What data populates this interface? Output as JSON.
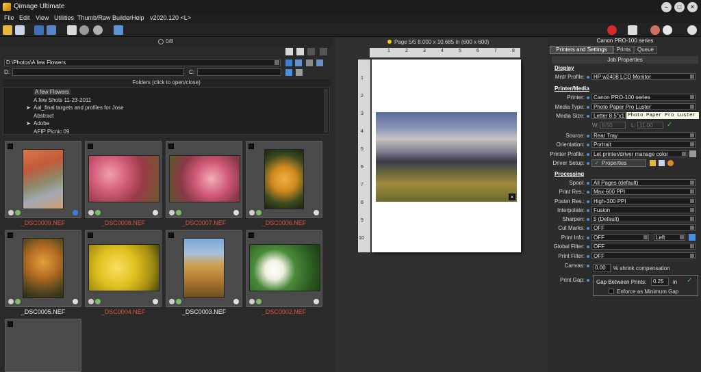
{
  "app": {
    "title": "Qimage Ultimate"
  },
  "menu": [
    "File",
    "Edit",
    "View",
    "Utilities",
    "Thumb/Raw Builder",
    "Help",
    "v2020.120 <L>"
  ],
  "left_panel": {
    "selection_count": "0/8",
    "path": "D:\\Photos\\A few Flowers",
    "drive_d_label": "D:",
    "drive_c_label": "C:",
    "folders_header": "Folders (click to open/close)",
    "folders": [
      {
        "name": "A few Flowers",
        "selected": true,
        "expandable": false
      },
      {
        "name": "A few Shots 11-23-2011",
        "selected": false,
        "expandable": false
      },
      {
        "name": "Aal_final targets and profiles for Jose",
        "selected": false,
        "expandable": true
      },
      {
        "name": "Abstract",
        "selected": false,
        "expandable": false
      },
      {
        "name": "Adobe",
        "selected": false,
        "expandable": true
      },
      {
        "name": "AFIP Picnic 09",
        "selected": false,
        "expandable": false
      }
    ],
    "thumbnails": [
      {
        "filename": "_DSC0009.NEF",
        "printed": true
      },
      {
        "filename": "_DSC0008.NEF",
        "printed": true
      },
      {
        "filename": "_DSC0007.NEF",
        "printed": true
      },
      {
        "filename": "_DSC0006.NEF",
        "printed": true
      },
      {
        "filename": "_DSC0005.NEF",
        "printed": false
      },
      {
        "filename": "_DSC0004.NEF",
        "printed": true
      },
      {
        "filename": "_DSC0003.NEF",
        "printed": false
      },
      {
        "filename": "_DSC0002.NEF",
        "printed": true
      }
    ]
  },
  "preview": {
    "page_info": "Page 5/5  8.000 x 10.685 in  (600 x 600)",
    "ruler_top": [
      "1",
      "2",
      "3",
      "4",
      "5",
      "6",
      "7",
      "8"
    ],
    "ruler_left": [
      "1",
      "2",
      "3",
      "4",
      "5",
      "6",
      "7",
      "8",
      "9",
      "10"
    ]
  },
  "right_panel": {
    "printer_name": "Canon PRO-100 series",
    "tabs": [
      "Printers and Settings",
      "Prints",
      "Queue"
    ],
    "active_tab": "Printers and Settings",
    "section_title": "Job Properties",
    "display": {
      "heading": "Display",
      "monitor_label": "Mntr Profile:",
      "monitor_value": "HP w2408 LCD Monitor"
    },
    "printer_media": {
      "heading": "Printer/Media",
      "printer_label": "Printer:",
      "printer_value": "Canon PRO-100 series",
      "media_type_label": "Media Type:",
      "media_type_value": "Photo Paper Pro Luster",
      "tooltip": "Photo Paper Pro Luster",
      "media_size_label": "Media Size:",
      "media_size_value": "Letter 8.5\"x1",
      "w_label": "W:",
      "w_value": "8.50",
      "l_label": "L:",
      "l_value": "11.00",
      "source_label": "Source:",
      "source_value": "Rear Tray",
      "orientation_label": "Orientation:",
      "orientation_value": "Portrait",
      "profile_label": "Printer Profile:",
      "profile_value": "Let printer/driver manage color",
      "driver_label": "Driver Setup:",
      "driver_button": "Properties"
    },
    "processing": {
      "heading": "Processing",
      "rows": [
        {
          "label": "Spool:",
          "value": "All Pages (default)"
        },
        {
          "label": "Print Res.:",
          "value": "Max-600 PPI"
        },
        {
          "label": "Poster Res.:",
          "value": "High-300 PPI"
        },
        {
          "label": "Interpolate:",
          "value": "Fusion"
        },
        {
          "label": "Sharpen:",
          "value": "5 (Default)"
        },
        {
          "label": "Cut Marks:",
          "value": "OFF"
        }
      ],
      "print_info_label": "Print Info:",
      "print_info_value": "OFF",
      "print_info_pos": "Left",
      "global_filter_label": "Global Filter:",
      "global_filter_value": "OFF",
      "print_filter_label": "Print Filter:",
      "print_filter_value": "OFF",
      "canvas_label": "Canvas:",
      "canvas_value": "0.00",
      "canvas_suffix": "% shrink compensation",
      "print_gap_label": "Print Gap:",
      "gap_label": "Gap Between Prints:",
      "gap_value": "0.25",
      "gap_unit": "in",
      "enforce_label": "Enforce as Minimum Gap"
    }
  },
  "colors": {
    "printed_name": "#e0503a",
    "accent_blue": "#4a8ee0",
    "check_green": "#47c04a"
  }
}
